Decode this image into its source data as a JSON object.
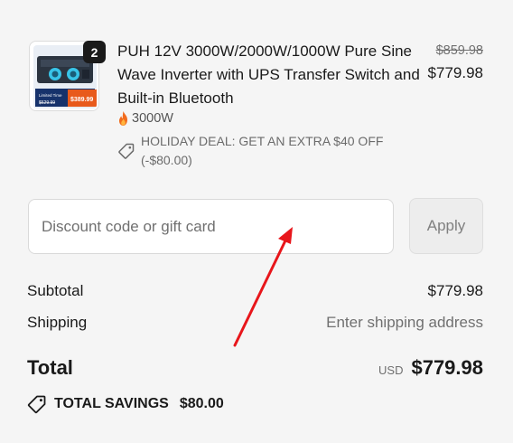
{
  "cart_item": {
    "quantity": "2",
    "title": "PUH 12V 3000W/2000W/1000W Pure Sine Wave Inverter with UPS Transfer Switch and Built-in Bluetooth",
    "compare_at_price": "$859.98",
    "price": "$779.98",
    "variant": "3000W",
    "deal": "HOLIDAY DEAL: GET AN EXTRA $40 OFF (-$80.00)",
    "thumbnail": {
      "banner_text": "Limited Time",
      "old_price": "$629.99",
      "new_price": "$389.99"
    }
  },
  "discount": {
    "placeholder": "Discount code or gift card",
    "value": "",
    "apply_label": "Apply"
  },
  "summary": {
    "subtotal_label": "Subtotal",
    "subtotal_value": "$779.98",
    "shipping_label": "Shipping",
    "shipping_value": "Enter shipping address",
    "total_label": "Total",
    "currency": "USD",
    "total_value": "$779.98",
    "savings_label": "TOTAL SAVINGS",
    "savings_value": "$80.00"
  },
  "icons": {
    "variant_icon": "fire-icon",
    "deal_icon": "tag-icon",
    "savings_icon": "tag-icon",
    "annotation": "red-arrow"
  },
  "colors": {
    "annotation_arrow": "#e8161b",
    "badge_bg": "#1a1a1a",
    "apply_bg": "#ededed"
  }
}
